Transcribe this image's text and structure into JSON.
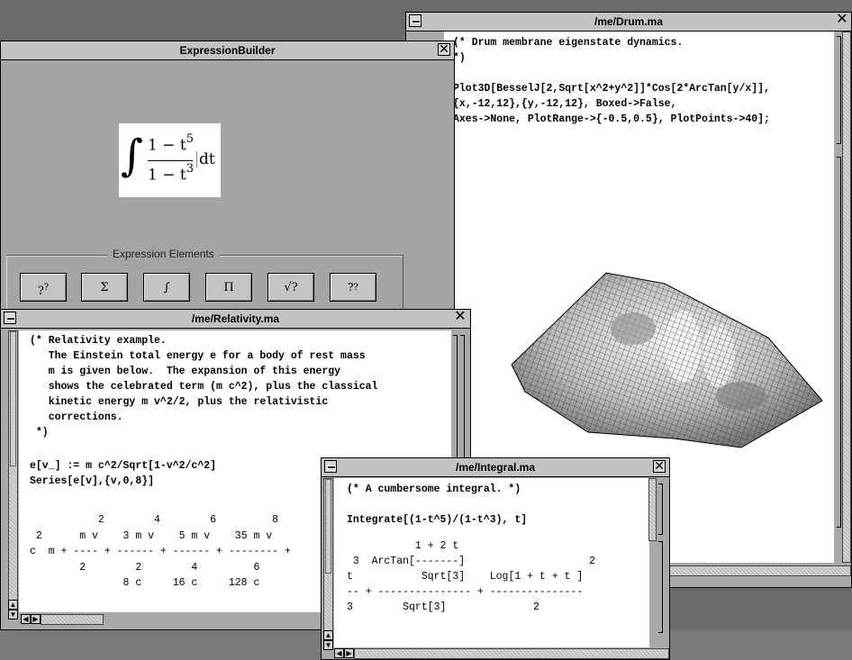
{
  "drum": {
    "title": "/me/Drum.ma",
    "code": "(* Drum membrane eigenstate dynamics.\n*)\n\nPlot3D[BesselJ[2,Sqrt[x^2+y^2]]*Cos[2*ArcTan[y/x]],\n{x,-12,12},{y,-12,12}, Boxed->False,\nAxes->None, PlotRange->{-0.5,0.5}, PlotPoints->40];"
  },
  "builder": {
    "title": "ExpressionBuilder",
    "integral_sign": "∫",
    "numerator": "1 − t",
    "numerator_exp": "5",
    "denominator": "1 − t",
    "denominator_exp": "3",
    "differential": "dt",
    "group_label": "Expression Elements",
    "buttons": [
      "?",
      "Σ",
      "∫",
      "Π",
      "√?",
      "?"
    ],
    "button_sup": "?",
    "button_sub": "?"
  },
  "relativity": {
    "title": "/me/Relativity.ma",
    "comment": "(* Relativity example.\n   The Einstein total energy e for a body of rest mass\n   m is given below.  The expansion of this energy\n   shows the celebrated term (m c^2), plus the classical\n   kinetic energy m v^2/2, plus the relativistic\n   corrections.\n *)",
    "input": "e[v_] := m c^2/Sqrt[1-v^2/c^2]\nSeries[e[v],{v,0,8}]",
    "output": "           2        4        6         8\n 2      m v    3 m v    5 m v    35 m v\nc  m + ---- + ------ + ------ + -------- +\n        2        2        4         6\n               8 c     16 c     128 c"
  },
  "integral": {
    "title": "/me/Integral.ma",
    "comment": "(* A cumbersome integral. *)",
    "input": "Integrate[(1-t^5)/(1-t^3), t]",
    "output": "           1 + 2 t\n 3  ArcTan[-------]                    2\nt           Sqrt[3]    Log[1 + t + t ]\n-- + --------------- + ---------------\n3        Sqrt[3]              2"
  }
}
